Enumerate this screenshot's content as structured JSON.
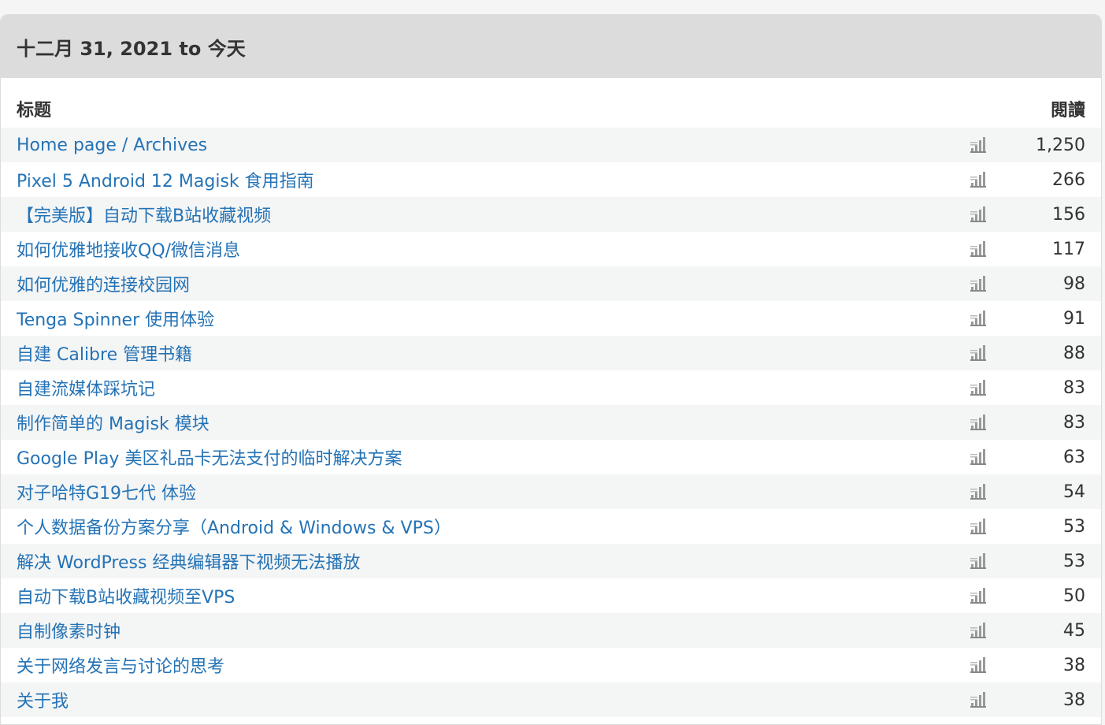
{
  "header": {
    "title": "十二月 31, 2021 to 今天"
  },
  "columns": {
    "title": "标题",
    "views": "閱讀"
  },
  "rows": [
    {
      "title": "Home page / Archives",
      "views": "1,250"
    },
    {
      "title": "Pixel 5 Android 12 Magisk 食用指南",
      "views": "266"
    },
    {
      "title": "【完美版】自动下载B站收藏视频",
      "views": "156"
    },
    {
      "title": "如何优雅地接收QQ/微信消息",
      "views": "117"
    },
    {
      "title": "如何优雅的连接校园网",
      "views": "98"
    },
    {
      "title": "Tenga Spinner 使用体验",
      "views": "91"
    },
    {
      "title": "自建 Calibre 管理书籍",
      "views": "88"
    },
    {
      "title": "自建流媒体踩坑记",
      "views": "83"
    },
    {
      "title": "制作简单的 Magisk 模块",
      "views": "83"
    },
    {
      "title": "Google Play 美区礼品卡无法支付的临时解决方案",
      "views": "63"
    },
    {
      "title": "对子哈特G19七代 体验",
      "views": "54"
    },
    {
      "title": "个人数据备份方案分享（Android & Windows & VPS）",
      "views": "53"
    },
    {
      "title": "解决 WordPress 经典编辑器下视频无法播放",
      "views": "53"
    },
    {
      "title": "自动下载B站收藏视频至VPS",
      "views": "50"
    },
    {
      "title": "自制像素时钟",
      "views": "45"
    },
    {
      "title": "关于网络发言与讨论的思考",
      "views": "38"
    },
    {
      "title": "关于我",
      "views": "38"
    }
  ],
  "icons": {
    "row_action": "bar-chart-icon"
  },
  "colors": {
    "link": "#2473b6",
    "header_bg": "#dcdcdc",
    "stripe": "#f4f5f5"
  }
}
